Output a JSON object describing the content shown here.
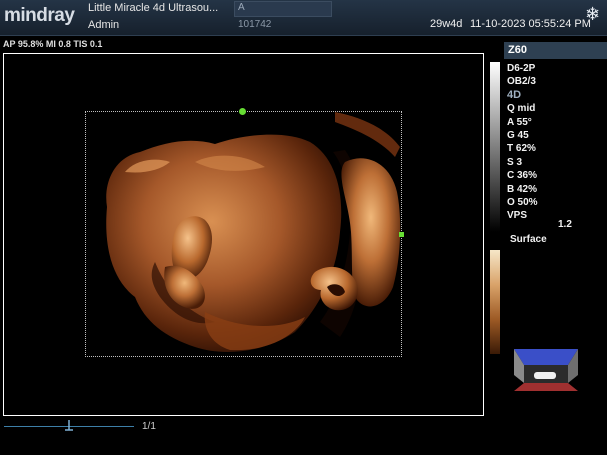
{
  "header": {
    "logo": "mindray",
    "hospital": "Little Miracle 4d Ultrasou...",
    "user": "Admin",
    "patient_name": "A",
    "patient_id": "101742",
    "gestational_age": "29w4d",
    "datetime": "11-10-2023  05:55:24 PM",
    "freeze_icon": "snowflake-icon"
  },
  "status_line": "AP 95.8%  MI 0.8 TIS 0.1",
  "footer": {
    "page": "1/1"
  },
  "right_panel": {
    "zoom_label": "Z60",
    "probe": "D6-2P",
    "exam": "OB2/3",
    "mode": "4D",
    "params": [
      "Q mid",
      "A 55°",
      "G 45",
      "T 62%",
      "S 3",
      "C 36%",
      "B 42%",
      "O 50%"
    ],
    "vps_label": "VPS",
    "vps_value": "1.2",
    "render_mode": "Surface"
  },
  "colors": {
    "topbar": "#1c2a39",
    "skin_light": "#d7884a",
    "skin_dark": "#3a1505",
    "roi_marker": "#66dd33"
  }
}
